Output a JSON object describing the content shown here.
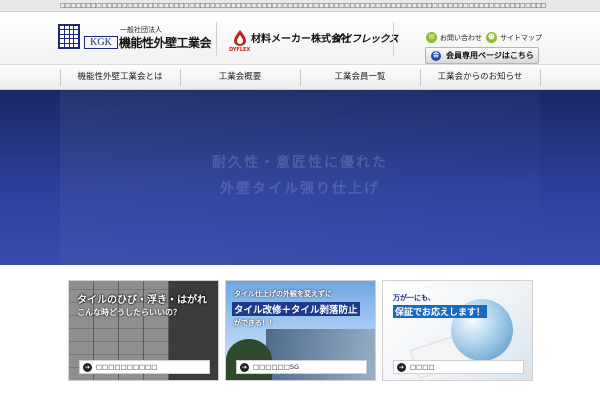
{
  "top_strip": {
    "text": "□□□□□□□□□□□□□□□□□□□□□□□□□□□□□□□□□□□□□□□□□□□□□□□□□□□□□□□□□□□□□□□□□□□□□□□□□□□□□□□□□□□□□□□□□□□□□□"
  },
  "header": {
    "org_type": "一般社団法人",
    "logo_abbr": "KGK",
    "org_name": "機能性外壁工業会",
    "sponsor_mark": "DYFLEX",
    "sponsor_label": "材料メーカー株式会社",
    "sponsor_name": "ダイフレックス",
    "contact_link": "お問い合わせ",
    "sitemap_link": "サイトマップ",
    "member_button": "会員専用ページはこちら",
    "member_icon_text": "会"
  },
  "nav": {
    "items": [
      {
        "label": "機能性外壁工業会とは"
      },
      {
        "label": "工業会概要"
      },
      {
        "label": "工業会員一覧"
      },
      {
        "label": "工業会からのお知らせ"
      }
    ]
  },
  "hero": {
    "line1": "耐久性・意匠性に優れた",
    "line2": "外壁タイル張り仕上げ"
  },
  "banners": [
    {
      "headline": "タイルのひび・浮き・はがれ",
      "subline": "こんな時どうしたらいいの？",
      "button": "□□□□□□□□□□"
    },
    {
      "headline": "タイル仕上げの外観を変えずに",
      "highlight": "タイル改修＋タイル剥落防止",
      "subline": "ができる！！",
      "button": "□□□□□□SG"
    },
    {
      "headline": "万が一にも、",
      "highlight": "保証でお応えします！",
      "button": "□□□□"
    }
  ],
  "colors": {
    "brand_navy": "#1d2a78",
    "hero_top": "#1a2766",
    "hero_bottom": "#3a4cad",
    "icon_green": "#8cbd2a",
    "dyflex_red": "#c0281c"
  }
}
